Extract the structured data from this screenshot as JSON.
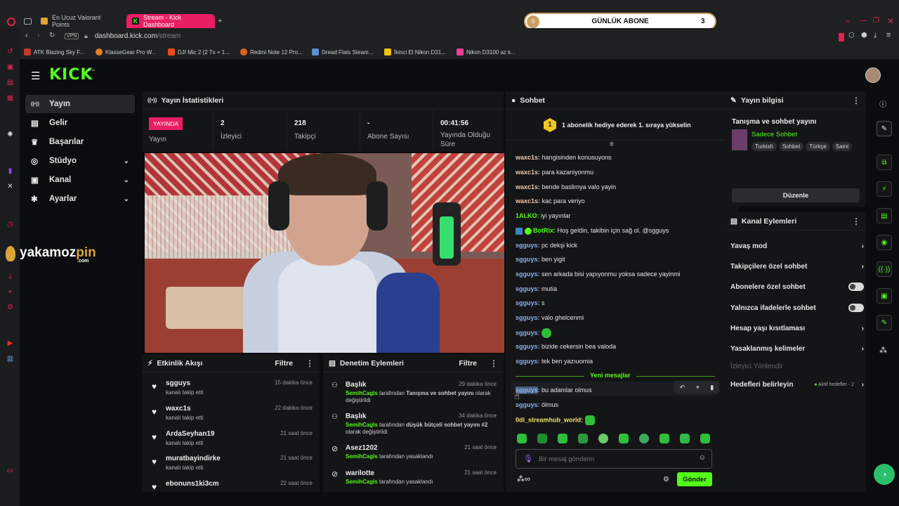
{
  "browser": {
    "tabs": [
      {
        "label": "En Ucuz Valorant Points",
        "active": false
      },
      {
        "label": "Stream - Kick Dashboard",
        "active": true
      }
    ],
    "new_tab": "+",
    "vpn": "VPN",
    "url_host": "dashboard.kick.com",
    "url_path": "/stream",
    "bookmarks": [
      {
        "label": "ATK Blazing Sky F...",
        "color": "#c0392b"
      },
      {
        "label": "KlasseGear Pro W...",
        "color": "#e67e22"
      },
      {
        "label": "DJI Mic 2 (2 Tx + 1...",
        "color": "#e84a1a"
      },
      {
        "label": "Redmi Note 12 Pro...",
        "color": "#e8601a"
      },
      {
        "label": "Dread Flats Steam...",
        "color": "#5b8fd6"
      },
      {
        "label": "İkinci El Nikon D31...",
        "color": "#f1c40f"
      },
      {
        "label": "Nikon D3100 az k...",
        "color": "#e84393"
      }
    ]
  },
  "overlay": {
    "badge": "0",
    "label": "GÜNLÜK ABONE",
    "count": "3",
    "watermark_main": "yakamoz",
    "watermark_accent": "pin",
    "watermark_sub": ".com"
  },
  "header": {
    "logo": "KICK",
    "beta": "BETA"
  },
  "nav": {
    "items": [
      {
        "label": "Yayın",
        "icon": "broadcast-icon",
        "glyph": "((•))",
        "active": true,
        "expand": false
      },
      {
        "label": "Gelir",
        "icon": "revenue-icon",
        "glyph": "▤",
        "active": false,
        "expand": false
      },
      {
        "label": "Başarılar",
        "icon": "trophy-icon",
        "glyph": "♛",
        "active": false,
        "expand": false
      },
      {
        "label": "Stüdyo",
        "icon": "studio-icon",
        "glyph": "◎",
        "active": false,
        "expand": true
      },
      {
        "label": "Kanal",
        "icon": "channel-icon",
        "glyph": "▣",
        "active": false,
        "expand": true
      },
      {
        "label": "Ayarlar",
        "icon": "gear-icon",
        "glyph": "✱",
        "active": false,
        "expand": true
      }
    ]
  },
  "stats": {
    "title": "Yayın İstatistikleri",
    "live_badge": "YAYINDA",
    "live_label": "Yayın",
    "items": [
      {
        "value": "2",
        "label": "İzleyici"
      },
      {
        "value": "218",
        "label": "Takipçi"
      },
      {
        "value": "-",
        "label": "Abone Sayısı"
      },
      {
        "value": "00:41:56",
        "label": "Yayında Olduğu Süre"
      }
    ]
  },
  "activity": {
    "title": "Etkinlik Akışı",
    "filter": "Filtre",
    "items": [
      {
        "name": "sgguys",
        "desc": "kanalı takip etti",
        "time": "15 dakika önce"
      },
      {
        "name": "waxc1s",
        "desc": "kanalı takip etti",
        "time": "22 dakika önce"
      },
      {
        "name": "ArdaSeyhan19",
        "desc": "kanalı takip etti",
        "time": "21 saat önce"
      },
      {
        "name": "muratbayindirke",
        "desc": "kanalı takip etti",
        "time": "21 saat önce"
      },
      {
        "name": "ebonuns1ki3cm",
        "desc": "",
        "time": "22 saat önce"
      }
    ]
  },
  "moderation": {
    "title": "Denetim Eylemleri",
    "filter": "Filtre",
    "items": [
      {
        "name": "Başlık",
        "actor": "SemihCagls",
        "text": " tarafından ",
        "bold": "Tanışma ve sohbet yayını",
        "tail": " olarak değiştirildi",
        "time": "29 dakika önce"
      },
      {
        "name": "Başlık",
        "actor": "SemihCagls",
        "text": " tarafından ",
        "bold": "düşük bütçeli sohbet yayını #2",
        "tail": " olarak değiştirildi",
        "time": "34 dakika önce"
      },
      {
        "name": "Asez1202",
        "actor": "SemihCagls",
        "text": " tarafından yasaklandı",
        "bold": "",
        "tail": "",
        "time": "21 saat önce"
      },
      {
        "name": "warilotte",
        "actor": "SemihCagls",
        "text": " tarafından yasaklandı",
        "bold": "",
        "tail": "",
        "time": "21 saat önce"
      }
    ]
  },
  "chat": {
    "title": "Sohbet",
    "pinned_rank": "1",
    "pinned_text": "1 abonelik hediye ederek 1. sıraya yükselin",
    "messages": [
      {
        "user": "waxc1s",
        "cls": "u-w",
        "text": "hangisinden konusuyons"
      },
      {
        "user": "waxc1s",
        "cls": "u-w",
        "text": "para kazaniyonmu"
      },
      {
        "user": "waxc1s",
        "cls": "u-w",
        "text": "bende baslimya valo yayin"
      },
      {
        "user": "waxc1s",
        "cls": "u-w",
        "text": "kac para veriyo"
      },
      {
        "user": "1ALKO",
        "cls": "u-g",
        "text": "iyi yayınlar"
      },
      {
        "user": "BotRix",
        "cls": "u-g",
        "text": "Hoş geldin, takibin için sağ ol. @sgguys"
      },
      {
        "user": "sgguys",
        "cls": "u-s",
        "text": "pc dekşi kick"
      },
      {
        "user": "sgguys",
        "cls": "u-s",
        "text": "ben yigit"
      },
      {
        "user": "sgguys",
        "cls": "u-s",
        "text": "sen arkada bisi yapıyonmu yoksa sadece yayinmi"
      },
      {
        "user": "sgguys",
        "cls": "u-s",
        "text": "mutia"
      },
      {
        "user": "sgguys",
        "cls": "u-s",
        "text": "s"
      },
      {
        "user": "sgguys",
        "cls": "u-s",
        "text": "valo ghelcenmi"
      },
      {
        "user": "sgguys",
        "cls": "u-s",
        "text": ""
      },
      {
        "user": "sgguys",
        "cls": "u-s",
        "text": "bizide cekersin bea valoda"
      },
      {
        "user": "sgguys",
        "cls": "u-s",
        "text": "tek ben yazıuomia"
      }
    ],
    "new_messages": "Yeni mesajlar",
    "new": [
      {
        "user": "sgguys",
        "cls": "u-s",
        "text": "bu adamlar olmus"
      },
      {
        "user": "sgguys",
        "cls": "u-s",
        "text": "ölmus"
      },
      {
        "user": "0di_streamhub_world",
        "cls": "u-y",
        "text": ""
      }
    ],
    "input_placeholder": "Bir mesaj gönderin",
    "send": "Gönder"
  },
  "stream_info": {
    "title": "Yayın bilgisi",
    "stream_title": "Tanışma ve sohbet yayını",
    "category": "Sadece Sohbet",
    "tags": [
      "Turkish",
      "Sohbet",
      "Türkçe",
      "Sami"
    ],
    "edit": "Düzenle"
  },
  "channel_actions": {
    "title": "Kanal Eylemleri",
    "items": [
      {
        "label": "Yavaş mod",
        "type": "chevron",
        "disabled": false,
        "extra": ""
      },
      {
        "label": "Takipçilere özel sohbet",
        "type": "chevron",
        "disabled": false,
        "extra": ""
      },
      {
        "label": "Abonelere özel sohbet",
        "type": "toggle",
        "disabled": false,
        "extra": ""
      },
      {
        "label": "Yalnızca ifadelerle sohbet",
        "type": "toggle",
        "disabled": false,
        "extra": ""
      },
      {
        "label": "Hesap yaşı kısıtlaması",
        "type": "chevron",
        "disabled": false,
        "extra": ""
      },
      {
        "label": "Yasaklanmış kelimeler",
        "type": "chevron",
        "disabled": false,
        "extra": ""
      },
      {
        "label": "İzleyici Yönlendir",
        "type": "none",
        "disabled": true,
        "extra": ""
      },
      {
        "label": "Hedefleri belirleyin",
        "type": "chevron",
        "disabled": false,
        "extra": "Aktif hedefler - 2"
      }
    ]
  },
  "colors": {
    "brand": "#53fc18",
    "live": "#e91e63"
  }
}
